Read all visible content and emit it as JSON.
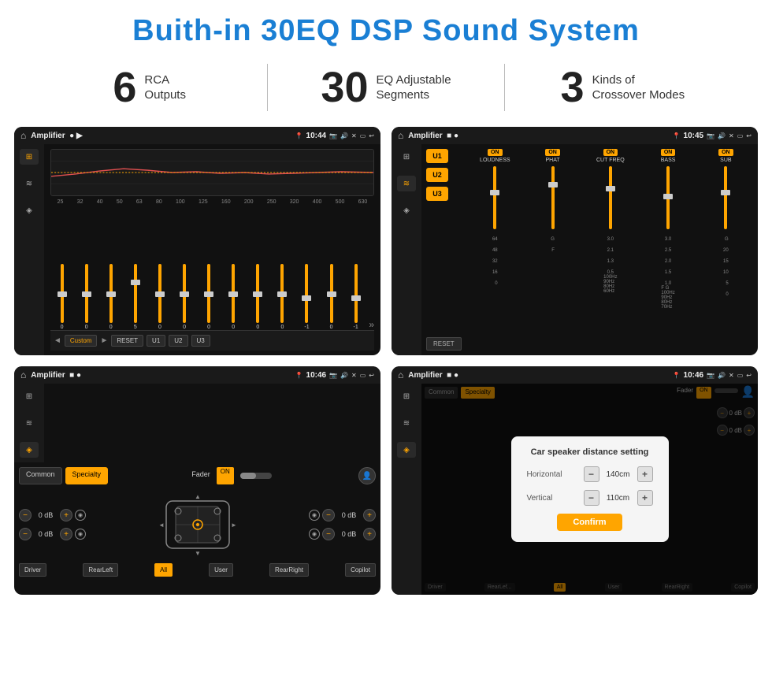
{
  "page": {
    "title": "Buith-in 30EQ DSP Sound System",
    "bg_color": "#ffffff"
  },
  "stats": [
    {
      "number": "6",
      "label_line1": "RCA",
      "label_line2": "Outputs"
    },
    {
      "divider": true
    },
    {
      "number": "30",
      "label_line1": "EQ Adjustable",
      "label_line2": "Segments"
    },
    {
      "divider": true
    },
    {
      "number": "3",
      "label_line1": "Kinds of",
      "label_line2": "Crossover Modes"
    }
  ],
  "screens": [
    {
      "id": "screen1",
      "title": "Amplifier",
      "time": "10:44",
      "type": "eq",
      "freq_labels": [
        "25",
        "32",
        "40",
        "50",
        "63",
        "80",
        "100",
        "125",
        "160",
        "200",
        "250",
        "320",
        "400",
        "500",
        "630"
      ],
      "slider_values": [
        "0",
        "0",
        "0",
        "5",
        "0",
        "0",
        "0",
        "0",
        "0",
        "0",
        "-1",
        "0",
        "-1"
      ],
      "bottom_btns": [
        "◄",
        "Custom",
        "►",
        "RESET",
        "U1",
        "U2",
        "U3"
      ]
    },
    {
      "id": "screen2",
      "title": "Amplifier",
      "time": "10:45",
      "type": "amp",
      "presets": [
        "U1",
        "U2",
        "U3"
      ],
      "controls": [
        {
          "on": true,
          "label": "LOUDNESS"
        },
        {
          "on": true,
          "label": "PHAT"
        },
        {
          "on": true,
          "label": "CUT FREQ"
        },
        {
          "on": true,
          "label": "BASS"
        },
        {
          "on": true,
          "label": "SUB"
        }
      ],
      "reset_btn": "RESET"
    },
    {
      "id": "screen3",
      "title": "Amplifier",
      "time": "10:46",
      "type": "fader",
      "tabs": [
        "Common",
        "Specialty"
      ],
      "fader_label": "Fader",
      "fader_on": "ON",
      "vol_rows": [
        {
          "value": "0 dB"
        },
        {
          "value": "0 dB"
        },
        {
          "value": "0 dB"
        },
        {
          "value": "0 dB"
        }
      ],
      "bottom_btns": [
        "Driver",
        "RearLeft",
        "All",
        "User",
        "RearRight",
        "Copilot"
      ]
    },
    {
      "id": "screen4",
      "title": "Amplifier",
      "time": "10:46",
      "type": "distance",
      "tabs": [
        "Common",
        "Specialty"
      ],
      "dialog": {
        "title": "Car speaker distance setting",
        "horizontal_label": "Horizontal",
        "horizontal_value": "140cm",
        "vertical_label": "Vertical",
        "vertical_value": "110cm",
        "confirm_label": "Confirm"
      },
      "bottom_btns": [
        "Driver",
        "RearLeft",
        "All",
        "User",
        "RearRight",
        "Copilot"
      ]
    }
  ]
}
